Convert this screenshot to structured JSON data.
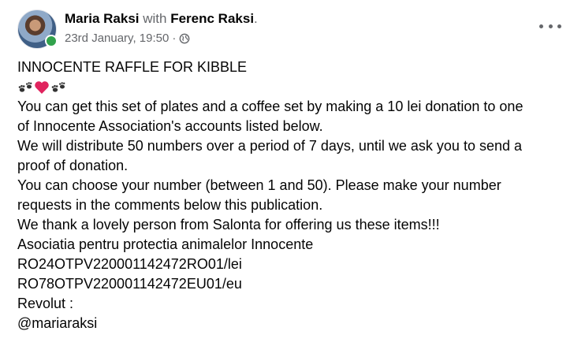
{
  "post": {
    "author": "Maria Raksi",
    "with_text": "with",
    "tagged": "Ferenc Raksi",
    "tag_suffix": ".",
    "timestamp": "23rd January, 19:50",
    "separator": "·",
    "privacy_icon": "globe-icon",
    "avatar_status_color": "#31a24c",
    "more_icon": "more-options-icon",
    "body_lines": [
      "INNOCENTE RAFFLE FOR KIBBLE",
      "You can get this set of plates and a coffee set by making a 10 lei donation to one",
      "of Innocente Association's accounts listed below.",
      "We will distribute 50 numbers over a period of 7 days, until we ask you to send a",
      "proof of donation.",
      "You can choose your number (between 1 and 50). Please make your number",
      "requests in the comments below this publication.",
      "We thank a lovely person from Salonta for offering us these items!!!",
      "Asociatia pentru protectia animalelor Innocente",
      "RO24OTPV220001142472RO01/lei",
      "RO78OTPV220001142472EU01/eu",
      "Revolut :",
      "@mariaraksi"
    ],
    "emoji_row": [
      "paw-prints-icon",
      "red-heart-icon",
      "paw-prints-icon"
    ]
  }
}
